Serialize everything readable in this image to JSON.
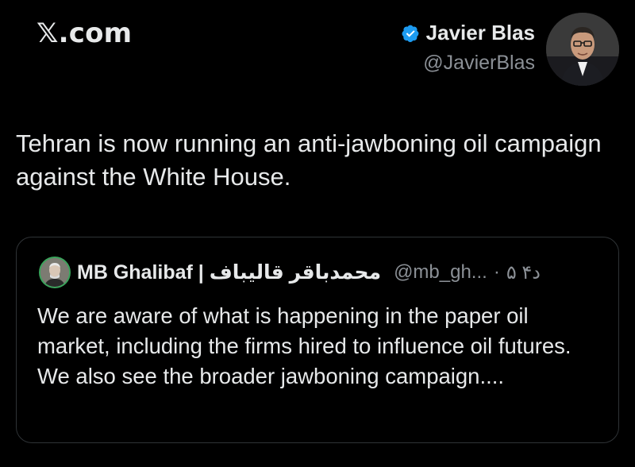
{
  "header": {
    "brand": "𝕏.com"
  },
  "author": {
    "name": "Javier Blas",
    "handle": "@JavierBlas",
    "verified_icon": "verified-badge-icon",
    "verified_color": "#1d9bf0"
  },
  "tweet": {
    "text": "Tehran is now running an anti-jawboning oil campaign against the White House."
  },
  "quoted": {
    "name": "MB Ghalibaf | محمدباقر قالیباف",
    "handle": "@mb_gh...",
    "separator": "·",
    "time": "۵ ۴د",
    "text": "We are aware of what is happening in the paper oil market, including the firms hired to influence oil futures. We also see the broader jawboning campaign...."
  }
}
